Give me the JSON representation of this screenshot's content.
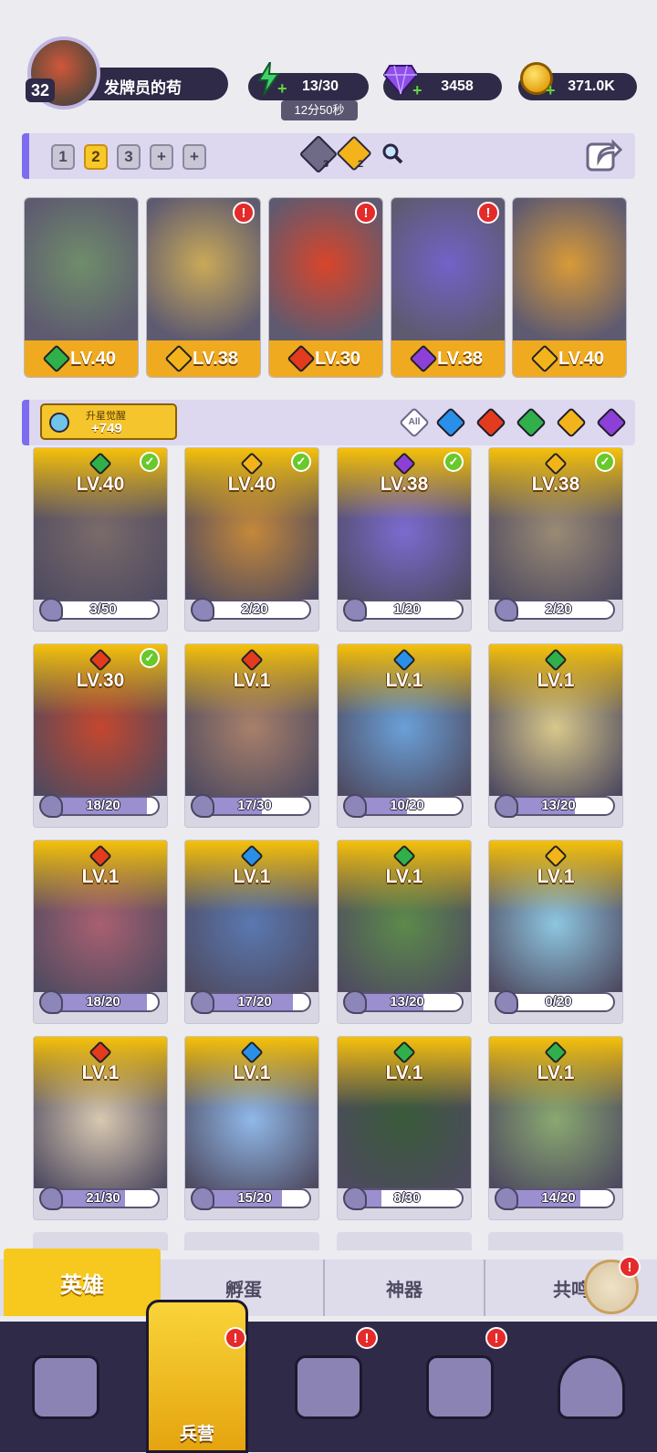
{
  "player": {
    "level": "32",
    "name": "发牌员的苟"
  },
  "resources": {
    "energy": "13/30",
    "energy_timer": "12分50秒",
    "gems": "3458",
    "gold": "371.0K"
  },
  "team_tabs": {
    "labels": [
      "1",
      "2",
      "3"
    ],
    "selected": "2",
    "add": "+",
    "counts": [
      "3",
      "2"
    ]
  },
  "team": [
    {
      "level": "LV.40",
      "element": "grass",
      "alert": false
    },
    {
      "level": "LV.38",
      "element": "light",
      "alert": true
    },
    {
      "level": "LV.30",
      "element": "fire",
      "alert": true
    },
    {
      "level": "LV.38",
      "element": "dark",
      "alert": true
    },
    {
      "level": "LV.40",
      "element": "light",
      "alert": false
    }
  ],
  "awaken": {
    "label": "升星觉醒",
    "value": "+749"
  },
  "filters": [
    "All",
    "water",
    "fire",
    "grass",
    "light",
    "dark"
  ],
  "heroes": [
    {
      "level": "LV.40",
      "element": "grass",
      "checked": true,
      "count": "3/50",
      "fraction": 0.06
    },
    {
      "level": "LV.40",
      "element": "light",
      "checked": true,
      "count": "2/20",
      "fraction": 0.1
    },
    {
      "level": "LV.38",
      "element": "dark",
      "checked": true,
      "count": "1/20",
      "fraction": 0.05
    },
    {
      "level": "LV.38",
      "element": "light",
      "checked": true,
      "count": "2/20",
      "fraction": 0.1
    },
    {
      "level": "LV.30",
      "element": "fire",
      "checked": true,
      "count": "18/20",
      "fraction": 0.9
    },
    {
      "level": "LV.1",
      "element": "fire",
      "checked": false,
      "count": "17/30",
      "fraction": 0.57
    },
    {
      "level": "LV.1",
      "element": "water",
      "checked": false,
      "count": "10/20",
      "fraction": 0.5
    },
    {
      "level": "LV.1",
      "element": "grass",
      "checked": false,
      "count": "13/20",
      "fraction": 0.65
    },
    {
      "level": "LV.1",
      "element": "fire",
      "checked": false,
      "count": "18/20",
      "fraction": 0.9
    },
    {
      "level": "LV.1",
      "element": "water",
      "checked": false,
      "count": "17/20",
      "fraction": 0.85
    },
    {
      "level": "LV.1",
      "element": "grass",
      "checked": false,
      "count": "13/20",
      "fraction": 0.65
    },
    {
      "level": "LV.1",
      "element": "light",
      "checked": false,
      "count": "0/20",
      "fraction": 0
    },
    {
      "level": "LV.1",
      "element": "fire",
      "checked": false,
      "count": "21/30",
      "fraction": 0.7
    },
    {
      "level": "LV.1",
      "element": "water",
      "checked": false,
      "count": "15/20",
      "fraction": 0.75
    },
    {
      "level": "LV.1",
      "element": "grass",
      "checked": false,
      "count": "8/30",
      "fraction": 0.27
    },
    {
      "level": "LV.1",
      "element": "grass",
      "checked": false,
      "count": "14/20",
      "fraction": 0.7
    }
  ],
  "subtabs": [
    "英雄",
    "孵蛋",
    "神器",
    "共鸣"
  ],
  "nav": {
    "active_label": "兵营",
    "alert": "!"
  },
  "colors": {
    "grass": "#2fb04a",
    "light": "#f2b41a",
    "fire": "#e23b1d",
    "dark": "#8d3fd8",
    "water": "#2a8fe8",
    "accent": "#f7c82a",
    "nav_bg": "#2f2a48"
  }
}
